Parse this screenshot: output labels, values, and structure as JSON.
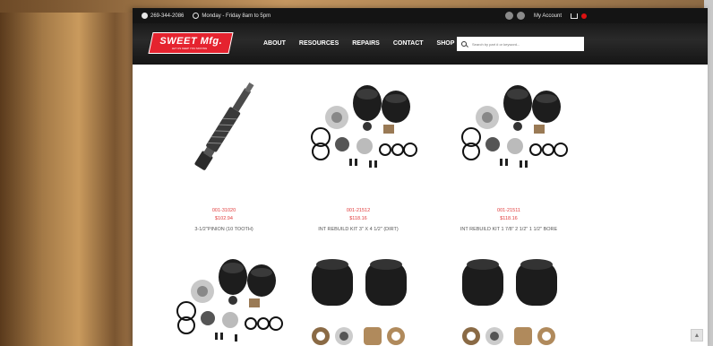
{
  "topbar": {
    "phone": "269-344-2086",
    "hours": "Monday - Friday 8am to 5pm",
    "account": "My Account"
  },
  "logo": {
    "name": "SWEET Mfg.",
    "tagline": "LET US KEEP YOU MOVING"
  },
  "nav": {
    "items": [
      "ABOUT",
      "RESOURCES",
      "REPAIRS",
      "CONTACT",
      "SHOP"
    ]
  },
  "search": {
    "placeholder": "Search by part # or keyword..."
  },
  "products": [
    {
      "sku": "001-31020",
      "price": "$102.94",
      "name": "3-1/2\"PINION (10 TOOTH)",
      "image": "pinion-shaft"
    },
    {
      "sku": "001-21512",
      "price": "$118.16",
      "name": "INT REBUILD KIT 3\" X 4 1/2\" (DIRT)",
      "image": "rebuild-kit"
    },
    {
      "sku": "001-21511",
      "price": "$118.16",
      "name": "INT REBUILD KIT 1 7/8\" 2 1/2\" 1 1/2\" BORE",
      "image": "rebuild-kit"
    },
    {
      "image": "rebuild-kit"
    },
    {
      "image": "boot-seal-kit"
    },
    {
      "image": "boot-seal-kit"
    }
  ],
  "colors": {
    "accent": "#e5232f",
    "price": "#e13b3b",
    "topbar": "#141414"
  }
}
